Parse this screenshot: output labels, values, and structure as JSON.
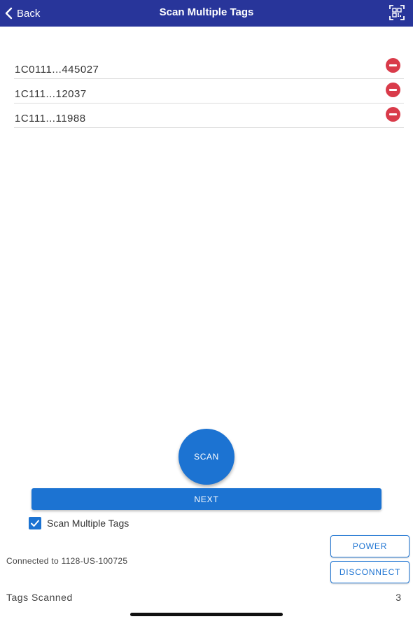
{
  "header": {
    "back_label": "Back",
    "title": "Scan Multiple Tags",
    "background_color": "#28359a"
  },
  "tags": [
    {
      "id": "1C0111...445027"
    },
    {
      "id": "1C111...12037"
    },
    {
      "id": "1C111...11988"
    }
  ],
  "actions": {
    "scan_label": "SCAN",
    "next_label": "NEXT",
    "accent_color": "#1c73d2"
  },
  "options": {
    "scan_multiple_label": "Scan Multiple Tags",
    "scan_multiple_checked": true
  },
  "status": {
    "connected_text": "Connected to 1128-US-100725",
    "power_label": "POWER",
    "disconnect_label": "DISCONNECT",
    "tags_scanned_label": "Tags Scanned",
    "tags_scanned_count": "3"
  },
  "icons": {
    "back": "chevron-left-icon",
    "qr": "qr-code-scan-icon",
    "remove": "minus-circle-icon",
    "check": "checkmark-icon"
  },
  "colors": {
    "remove_red": "#d93b4a"
  }
}
